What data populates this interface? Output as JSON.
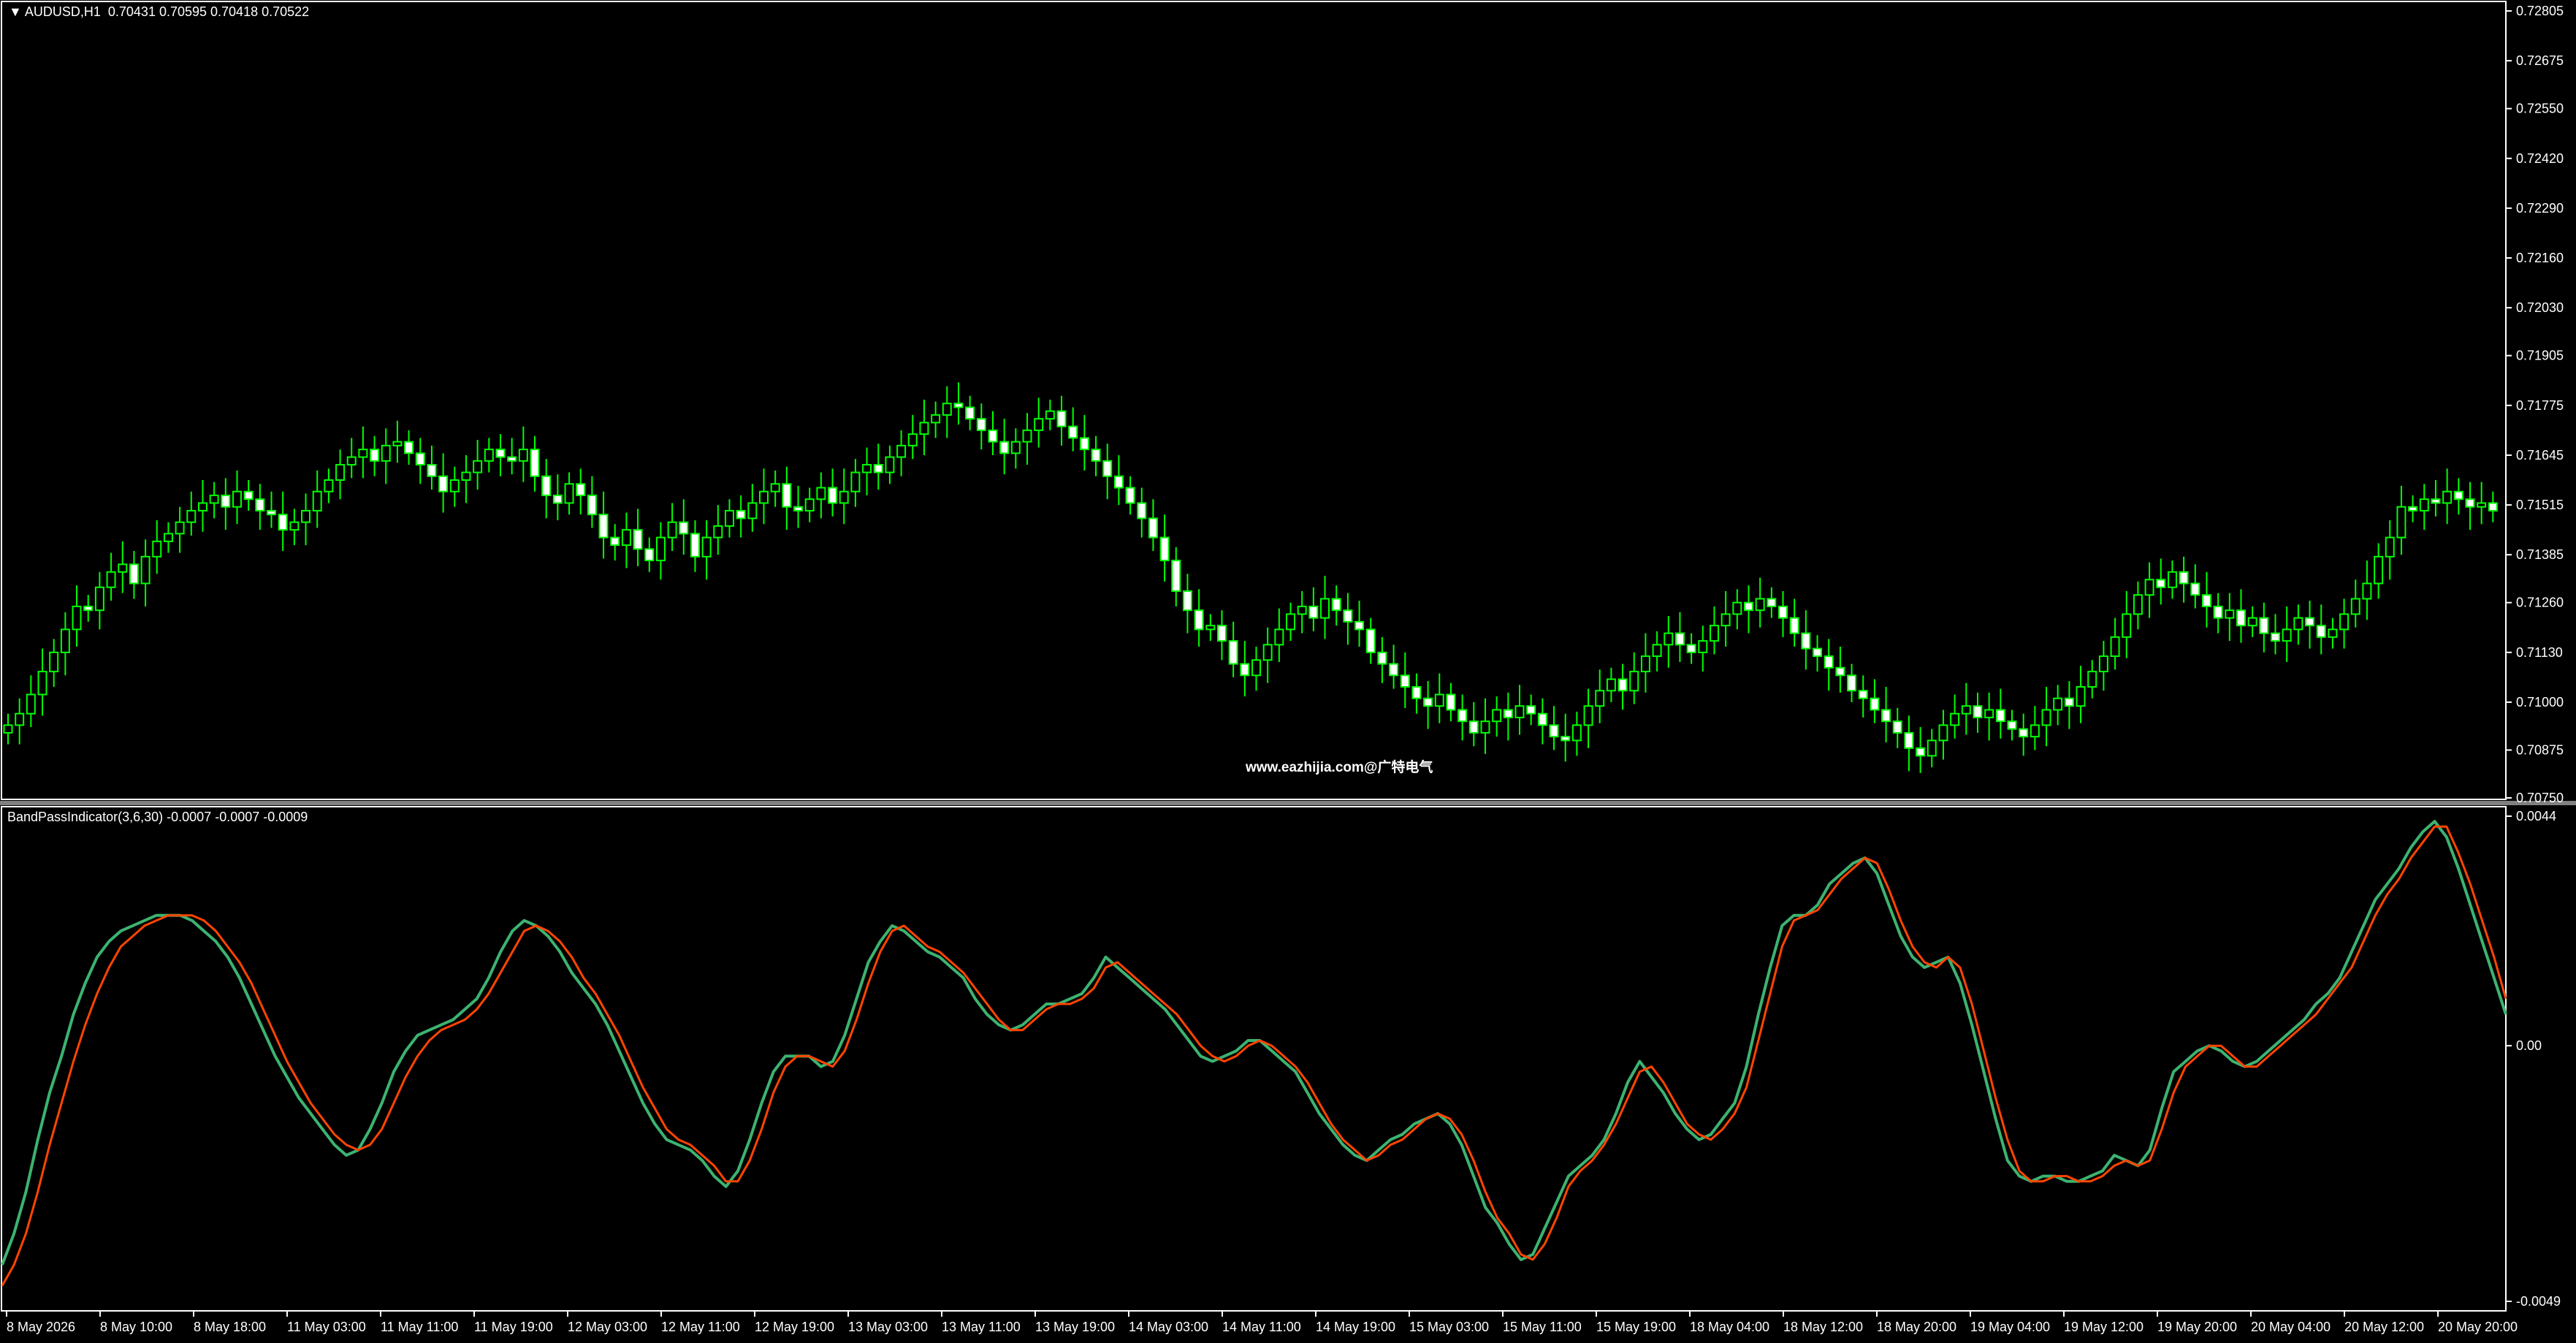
{
  "window": {
    "main_label": "AUDUSD,H1",
    "main_ohlc": "0.70431 0.70595 0.70418 0.70522",
    "indicator_label": "BandPassIndicator(3,6,30)",
    "indicator_values": "-0.0007 -0.0007 -0.0009",
    "watermark": "www.eazhijia.com@广特电气"
  },
  "colors": {
    "background": "#000000",
    "candle": "#00ff00",
    "candle_body": "#ffffff",
    "line_fast": "#3cb371",
    "line_slow": "#ff4500",
    "separator": "#808080"
  },
  "chart_data": [
    {
      "type": "candlestick",
      "symbol": "AUDUSD",
      "timeframe": "H1",
      "y_ticks": [
        "0.72805",
        "0.72675",
        "0.72550",
        "0.72420",
        "0.72290",
        "0.72160",
        "0.72030",
        "0.71905",
        "0.71775",
        "0.71645",
        "0.71515",
        "0.71385",
        "0.71260",
        "0.71130",
        "0.71000",
        "0.70875",
        "0.70750"
      ],
      "ylim": [
        0.7075,
        0.72805
      ],
      "close": [
        0.7094,
        0.7097,
        0.7102,
        0.7108,
        0.7113,
        0.7119,
        0.7125,
        0.7124,
        0.713,
        0.7134,
        0.7136,
        0.7131,
        0.7138,
        0.7142,
        0.7144,
        0.7147,
        0.715,
        0.7152,
        0.7154,
        0.7151,
        0.7155,
        0.7153,
        0.715,
        0.7149,
        0.7145,
        0.7147,
        0.715,
        0.7155,
        0.7158,
        0.7162,
        0.7164,
        0.7166,
        0.7163,
        0.7167,
        0.7168,
        0.7165,
        0.7162,
        0.7159,
        0.7155,
        0.7158,
        0.716,
        0.7163,
        0.7166,
        0.7164,
        0.7163,
        0.7166,
        0.7159,
        0.7154,
        0.7152,
        0.7157,
        0.7154,
        0.7149,
        0.7143,
        0.7141,
        0.7145,
        0.714,
        0.7137,
        0.7143,
        0.7147,
        0.7144,
        0.7138,
        0.7143,
        0.7146,
        0.715,
        0.7148,
        0.7152,
        0.7155,
        0.7157,
        0.7151,
        0.715,
        0.7153,
        0.7156,
        0.7152,
        0.7155,
        0.716,
        0.7162,
        0.716,
        0.7164,
        0.7167,
        0.717,
        0.7173,
        0.7175,
        0.7178,
        0.7177,
        0.7174,
        0.7171,
        0.7168,
        0.7165,
        0.7168,
        0.7171,
        0.7174,
        0.7176,
        0.7172,
        0.7169,
        0.7166,
        0.7163,
        0.7159,
        0.7156,
        0.7152,
        0.7148,
        0.7143,
        0.7137,
        0.7129,
        0.7124,
        0.7119,
        0.712,
        0.7116,
        0.711,
        0.7107,
        0.7111,
        0.7115,
        0.7119,
        0.7123,
        0.7125,
        0.7122,
        0.7127,
        0.7124,
        0.7121,
        0.7119,
        0.7113,
        0.711,
        0.7107,
        0.7104,
        0.7101,
        0.7099,
        0.7102,
        0.7098,
        0.7095,
        0.7092,
        0.7095,
        0.7098,
        0.7096,
        0.7099,
        0.7097,
        0.7094,
        0.7091,
        0.709,
        0.7094,
        0.7099,
        0.7103,
        0.7106,
        0.7103,
        0.7108,
        0.7112,
        0.7115,
        0.7118,
        0.7115,
        0.7113,
        0.7116,
        0.712,
        0.7123,
        0.7126,
        0.7124,
        0.7127,
        0.7125,
        0.7122,
        0.7118,
        0.7114,
        0.7112,
        0.7109,
        0.7107,
        0.7103,
        0.7101,
        0.7098,
        0.7095,
        0.7092,
        0.7088,
        0.7086,
        0.709,
        0.7094,
        0.7097,
        0.7099,
        0.7096,
        0.7098,
        0.7095,
        0.7093,
        0.7091,
        0.7094,
        0.7098,
        0.7101,
        0.7099,
        0.7104,
        0.7108,
        0.7112,
        0.7117,
        0.7123,
        0.7128,
        0.7132,
        0.713,
        0.7134,
        0.7131,
        0.7128,
        0.7125,
        0.7122,
        0.7124,
        0.712,
        0.7122,
        0.7118,
        0.7116,
        0.7119,
        0.7122,
        0.712,
        0.7117,
        0.7119,
        0.7123,
        0.7127,
        0.7131,
        0.7138,
        0.7143,
        0.7151,
        0.715,
        0.7153,
        0.7152,
        0.7155,
        0.7153,
        0.7151,
        0.7152,
        0.715
      ]
    },
    {
      "type": "line",
      "name": "BandPassIndicator(3,6,30)",
      "y_ticks": [
        "0.0044",
        "0.00",
        "-0.0049"
      ],
      "ylim": [
        -0.0049,
        0.0044
      ],
      "x_ticks": [
        "8 May 2026",
        "8 May 10:00",
        "8 May 18:00",
        "11 May 03:00",
        "11 May 11:00",
        "11 May 19:00",
        "12 May 03:00",
        "12 May 11:00",
        "12 May 19:00",
        "13 May 03:00",
        "13 May 11:00",
        "13 May 19:00",
        "14 May 03:00",
        "14 May 11:00",
        "14 May 19:00",
        "15 May 03:00",
        "15 May 11:00",
        "15 May 19:00",
        "18 May 04:00",
        "18 May 12:00",
        "18 May 20:00",
        "19 May 04:00",
        "19 May 12:00",
        "19 May 20:00",
        "20 May 04:00",
        "20 May 12:00",
        "20 May 20:00"
      ],
      "series": [
        {
          "values": [
            -0.0042,
            -0.0036,
            -0.0028,
            -0.0018,
            -0.0009,
            -0.0002,
            0.0006,
            0.0012,
            0.0017,
            0.002,
            0.0022,
            0.0023,
            0.0024,
            0.0025,
            0.0025,
            0.0025,
            0.0024,
            0.0022,
            0.002,
            0.0017,
            0.0013,
            0.0008,
            0.0003,
            -0.0002,
            -0.0006,
            -0.001,
            -0.0013,
            -0.0016,
            -0.0019,
            -0.0021,
            -0.002,
            -0.0016,
            -0.0011,
            -0.0005,
            -0.0001,
            0.0002,
            0.0003,
            0.0004,
            0.0005,
            0.0007,
            0.0009,
            0.0013,
            0.0018,
            0.0022,
            0.0024,
            0.0023,
            0.0021,
            0.0018,
            0.0014,
            0.0011,
            0.0008,
            0.0004,
            -0.0001,
            -0.0006,
            -0.0011,
            -0.0015,
            -0.0018,
            -0.0019,
            -0.002,
            -0.0022,
            -0.0025,
            -0.0027,
            -0.0024,
            -0.0018,
            -0.0011,
            -0.0005,
            -0.0002,
            -0.0002,
            -0.0002,
            -0.0004,
            -0.0003,
            0.0002,
            0.0009,
            0.0016,
            0.002,
            0.0023,
            0.0022,
            0.002,
            0.0018,
            0.0017,
            0.0015,
            0.0013,
            0.0009,
            0.0006,
            0.0004,
            0.0003,
            0.0004,
            0.0006,
            0.0008,
            0.0008,
            0.0009,
            0.001,
            0.0013,
            0.0017,
            0.0015,
            0.0013,
            0.0011,
            0.0009,
            0.0007,
            0.0004,
            0.0001,
            -0.0002,
            -0.0003,
            -0.0002,
            -0.0001,
            0.0001,
            0.0001,
            -0.0001,
            -0.0003,
            -0.0005,
            -0.0009,
            -0.0013,
            -0.0016,
            -0.0019,
            -0.0021,
            -0.0022,
            -0.002,
            -0.0018,
            -0.0017,
            -0.0015,
            -0.0014,
            -0.0013,
            -0.0015,
            -0.0019,
            -0.0025,
            -0.0031,
            -0.0034,
            -0.0038,
            -0.0041,
            -0.004,
            -0.0035,
            -0.003,
            -0.0025,
            -0.0023,
            -0.0021,
            -0.0018,
            -0.0013,
            -0.0007,
            -0.0003,
            -0.0006,
            -0.0009,
            -0.0013,
            -0.0016,
            -0.0018,
            -0.0017,
            -0.0014,
            -0.0011,
            -0.0004,
            0.0006,
            0.0015,
            0.0023,
            0.0025,
            0.0025,
            0.0027,
            0.0031,
            0.0033,
            0.0035,
            0.0036,
            0.0033,
            0.0027,
            0.0021,
            0.0017,
            0.0015,
            0.0016,
            0.0017,
            0.0012,
            0.0004,
            -0.0005,
            -0.0014,
            -0.0022,
            -0.0025,
            -0.0026,
            -0.0025,
            -0.0025,
            -0.0026,
            -0.0026,
            -0.0025,
            -0.0024,
            -0.0021,
            -0.0022,
            -0.0023,
            -0.002,
            -0.0012,
            -0.0005,
            -0.0003,
            -0.0001,
            0.0,
            -0.0001,
            -0.0003,
            -0.0004,
            -0.0003,
            -0.0001,
            0.0001,
            0.0003,
            0.0005,
            0.0008,
            0.001,
            0.0013,
            0.0018,
            0.0023,
            0.0028,
            0.0031,
            0.0034,
            0.0038,
            0.0041,
            0.0043,
            0.004,
            0.0034,
            0.0027,
            0.002,
            0.0013,
            0.0006
          ]
        },
        {
          "values": [
            -0.0046,
            -0.0042,
            -0.0036,
            -0.0028,
            -0.0019,
            -0.0011,
            -0.0003,
            0.0004,
            0.001,
            0.0015,
            0.0019,
            0.0021,
            0.0023,
            0.0024,
            0.0025,
            0.0025,
            0.0025,
            0.0024,
            0.0022,
            0.0019,
            0.0016,
            0.0012,
            0.0007,
            0.0002,
            -0.0003,
            -0.0007,
            -0.0011,
            -0.0014,
            -0.0017,
            -0.0019,
            -0.002,
            -0.0019,
            -0.0016,
            -0.0011,
            -0.0006,
            -0.0002,
            0.0001,
            0.0003,
            0.0004,
            0.0005,
            0.0007,
            0.001,
            0.0014,
            0.0018,
            0.0022,
            0.0023,
            0.0022,
            0.002,
            0.0017,
            0.0013,
            0.001,
            0.0006,
            0.0002,
            -0.0003,
            -0.0008,
            -0.0012,
            -0.0016,
            -0.0018,
            -0.0019,
            -0.0021,
            -0.0023,
            -0.0026,
            -0.0026,
            -0.0022,
            -0.0016,
            -0.0009,
            -0.0004,
            -0.0002,
            -0.0002,
            -0.0003,
            -0.0004,
            -0.0001,
            0.0005,
            0.0012,
            0.0018,
            0.0022,
            0.0023,
            0.0021,
            0.0019,
            0.0018,
            0.0016,
            0.0014,
            0.0011,
            0.0008,
            0.0005,
            0.0003,
            0.0003,
            0.0005,
            0.0007,
            0.0008,
            0.0008,
            0.0009,
            0.0011,
            0.0015,
            0.0016,
            0.0014,
            0.0012,
            0.001,
            0.0008,
            0.0006,
            0.0003,
            0.0,
            -0.0002,
            -0.0003,
            -0.0002,
            0.0,
            0.0001,
            0.0,
            -0.0002,
            -0.0004,
            -0.0007,
            -0.0011,
            -0.0015,
            -0.0018,
            -0.002,
            -0.0022,
            -0.0021,
            -0.0019,
            -0.0018,
            -0.0016,
            -0.0014,
            -0.0013,
            -0.0014,
            -0.0017,
            -0.0022,
            -0.0028,
            -0.0033,
            -0.0036,
            -0.004,
            -0.0041,
            -0.0038,
            -0.0033,
            -0.0027,
            -0.0024,
            -0.0022,
            -0.0019,
            -0.0015,
            -0.001,
            -0.0005,
            -0.0004,
            -0.0007,
            -0.0011,
            -0.0015,
            -0.0017,
            -0.0018,
            -0.0016,
            -0.0013,
            -0.0008,
            0.0001,
            0.001,
            0.0019,
            0.0024,
            0.0025,
            0.0026,
            0.0029,
            0.0032,
            0.0034,
            0.0036,
            0.0035,
            0.003,
            0.0024,
            0.0019,
            0.0016,
            0.0015,
            0.0017,
            0.0015,
            0.0008,
            -0.0001,
            -0.001,
            -0.0018,
            -0.0024,
            -0.0026,
            -0.0026,
            -0.0025,
            -0.0025,
            -0.0026,
            -0.0026,
            -0.0025,
            -0.0023,
            -0.0022,
            -0.0023,
            -0.0022,
            -0.0016,
            -0.0009,
            -0.0004,
            -0.0002,
            0.0,
            0.0,
            -0.0002,
            -0.0004,
            -0.0004,
            -0.0002,
            0.0,
            0.0002,
            0.0004,
            0.0006,
            0.0009,
            0.0012,
            0.0015,
            0.002,
            0.0025,
            0.0029,
            0.0032,
            0.0036,
            0.0039,
            0.0042,
            0.0042,
            0.0037,
            0.0031,
            0.0024,
            0.0017,
            0.0009
          ]
        }
      ]
    }
  ]
}
